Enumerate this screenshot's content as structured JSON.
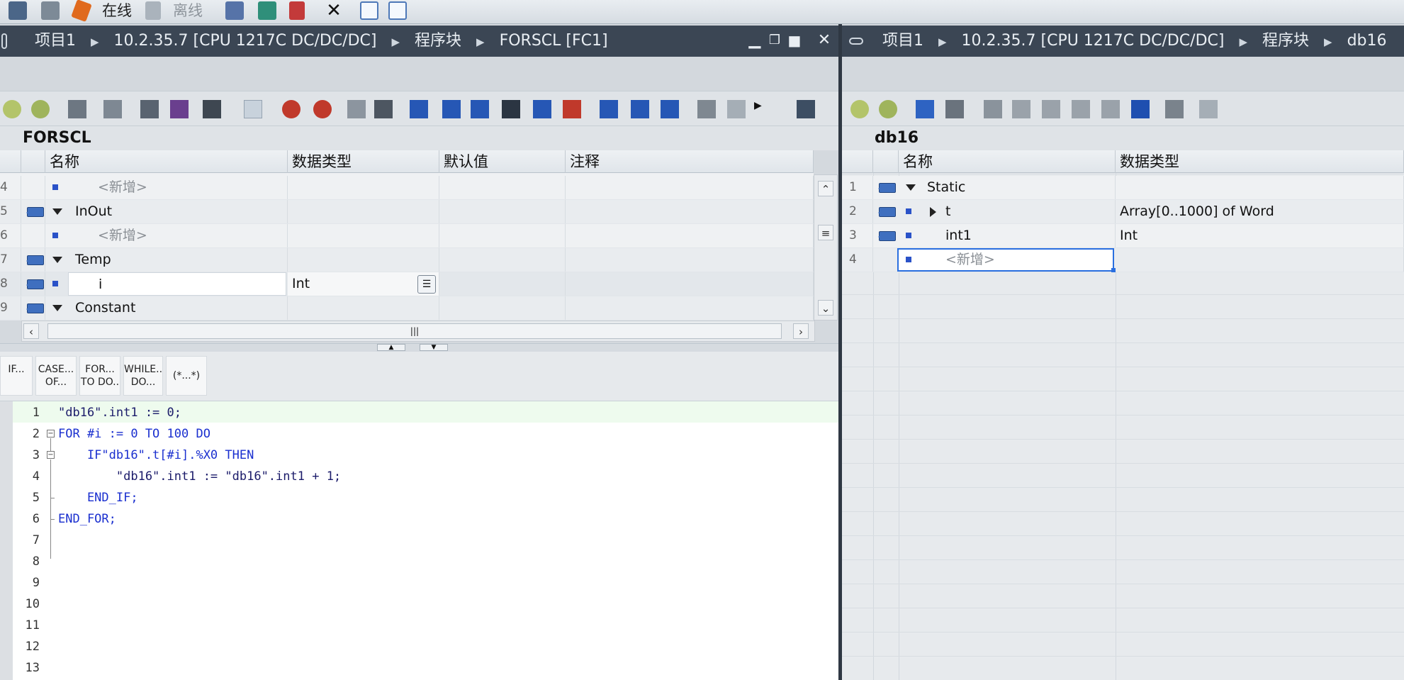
{
  "toolbar": {
    "online_label": "在线",
    "offline_label": "离线"
  },
  "left_panel": {
    "title": {
      "crumbs": [
        "项目1",
        "10.2.35.7 [CPU 1217C DC/DC/DC]",
        "程序块",
        "FORSCL [FC1]"
      ]
    },
    "block_name": "FORSCL",
    "columns": [
      "名称",
      "数据类型",
      "默认值",
      "注释"
    ],
    "rows": [
      {
        "num": "4",
        "name": "<新增>",
        "type": "",
        "kind": "add"
      },
      {
        "num": "5",
        "name": "InOut",
        "type": "",
        "kind": "section"
      },
      {
        "num": "6",
        "name": "<新增>",
        "type": "",
        "kind": "add"
      },
      {
        "num": "7",
        "name": "Temp",
        "type": "",
        "kind": "section"
      },
      {
        "num": "8",
        "name": "i",
        "type": "Int",
        "kind": "var"
      },
      {
        "num": "9",
        "name": "Constant",
        "type": "",
        "kind": "section"
      }
    ],
    "templates": [
      {
        "line1": "IF...",
        "line2": ""
      },
      {
        "line1": "CASE...",
        "line2": "OF..."
      },
      {
        "line1": "FOR...",
        "line2": "TO DO.."
      },
      {
        "line1": "WHILE..",
        "line2": "DO..."
      },
      {
        "line1": "(*...*)",
        "line2": ""
      }
    ],
    "code": {
      "line_numbers": [
        "1",
        "2",
        "3",
        "4",
        "5",
        "6",
        "7",
        "8",
        "9",
        "10",
        "11",
        "12",
        "13"
      ],
      "lines": [
        "\"db16\".int1 := 0;",
        "FOR #i := 0 TO 100 DO",
        "    IF\"db16\".t[#i].%X0 THEN",
        "        \"db16\".int1 := \"db16\".int1 + 1;",
        "    END_IF;",
        "END_FOR;"
      ]
    }
  },
  "right_panel": {
    "title": {
      "crumbs": [
        "项目1",
        "10.2.35.7 [CPU 1217C DC/DC/DC]",
        "程序块",
        "db16"
      ]
    },
    "block_name": "db16",
    "columns": [
      "名称",
      "数据类型"
    ],
    "rows": [
      {
        "num": "1",
        "name": "Static",
        "type": "",
        "kind": "section"
      },
      {
        "num": "2",
        "name": "t",
        "type": "Array[0..1000] of Word",
        "kind": "array"
      },
      {
        "num": "3",
        "name": "int1",
        "type": "Int",
        "kind": "var"
      },
      {
        "num": "4",
        "name": "<新增>",
        "type": "",
        "kind": "add"
      }
    ]
  },
  "colors": {
    "titlebar_bg": "#3b4654",
    "keyword": "#1a2fcf",
    "current_line": "#eefbee",
    "selection_border": "#2a6fe0"
  }
}
